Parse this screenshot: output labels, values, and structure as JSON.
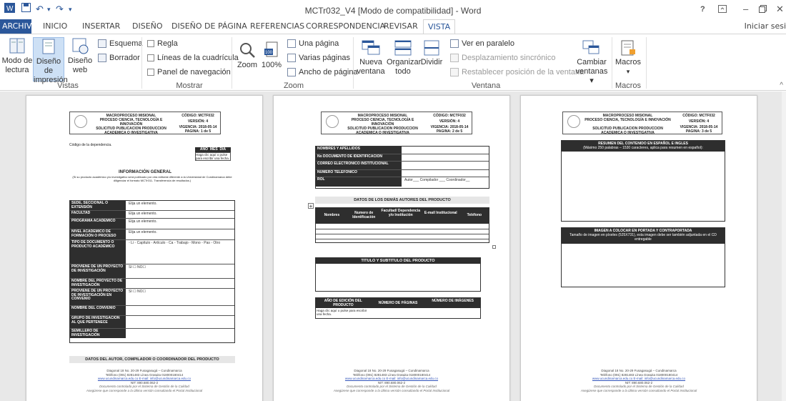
{
  "titlebar": {
    "title": "MCTr032_V4 [Modo de compatibilidad] - Word",
    "help": "?",
    "undo_glyph": "↶",
    "redo_glyph": "↷",
    "more_glyph": "▾",
    "minimize_glyph": "–",
    "close_glyph": "✕"
  },
  "tabs": [
    "ARCHIVO",
    "INICIO",
    "INSERTAR",
    "DISEÑO",
    "DISEÑO DE PÁGINA",
    "REFERENCIAS",
    "CORRESPONDENCIA",
    "REVISAR",
    "VISTA"
  ],
  "signin": "Iniciar sesi",
  "ribbon": {
    "vistas": {
      "label": "Vistas",
      "modo_lectura": "Modo de lectura",
      "diseno_impresion": "Diseño de impresión",
      "diseno_web": "Diseño web",
      "esquema": "Esquema",
      "borrador": "Borrador"
    },
    "mostrar": {
      "label": "Mostrar",
      "regla": "Regla",
      "lineas": "Líneas de la cuadrícula",
      "panel": "Panel de navegación"
    },
    "zoom": {
      "label": "Zoom",
      "zoom": "Zoom",
      "pct": "100%",
      "una_pagina": "Una página",
      "varias_paginas": "Varias páginas",
      "ancho_pagina": "Ancho de página"
    },
    "ventana": {
      "label": "Ventana",
      "nueva": "Nueva ventana",
      "organizar": "Organizar todo",
      "dividir": "Dividir",
      "paralelo": "Ver en paralelo",
      "desplazamiento": "Desplazamiento sincrónico",
      "restablecer": "Restablecer posición de la ventana",
      "cambiar": "Cambiar ventanas ▾"
    },
    "macros": {
      "label": "Macros",
      "macros": "Macros",
      "arrow": "▾"
    }
  },
  "doc_header": {
    "line1": "MACROPROCESO MISIONAL",
    "line2": "PROCESO CIENCIA, TECNOLOGÍA E INNOVACIÓN",
    "line3": "SOLICITUD PUBLICACION PRODUCCION ACADEMICA O INVESTIGATIVA",
    "codigo": "CÓDIGO: MCTF032",
    "version": "VERSIÓN: 4",
    "vigencia": "VIGENCIA: 2018-05-14",
    "pag1": "PAGINA: 1 de 5",
    "pag2": "PAGINA: 2 de 5",
    "pag3": "PAGINA: 3 de 5"
  },
  "page1": {
    "codigo_dep": "Código de la dependencia.",
    "fecha_head": [
      "AÑO",
      "MES",
      "DÍA"
    ],
    "fecha_val": "Haga clic aquí o pulse para escribir una fecha.",
    "info_general": "INFORMACIÓN GENERAL",
    "info_note": "(Si su producto académico y/o investigativo será publicado por otra editorial diferente a la Universidad de Cundinamarca debe diligenciar el formato MCTr011- Transferencia de resultados.)",
    "rows": [
      {
        "label": "SEDE, SECCIONAL O EXTENSIÓN",
        "value": "Elija un elemento."
      },
      {
        "label": "FACULTAD",
        "value": "Elija un elemento."
      },
      {
        "label": "PROGRAMA ACADÉMICO",
        "value": "Elija un elemento."
      },
      {
        "label": "NIVEL ACADÉMICO DE FORMACIÓN O PROCESO",
        "value": "Elija un elemento."
      },
      {
        "label": "TIPO DE DOCUMENTO O PRODUCTO ACADÉMICO",
        "value": "◦ Li ◦ Capítulo ◦ Artículo ◦ Ca ◦ Trabajo ◦ Mono ◦ Pas ◦ Otro"
      },
      {
        "label": "PROVIENE DE UN PROYECTO DE INVESTIGACIÓN",
        "value": "SI ☐      NO☐"
      },
      {
        "label": "NOMBRE DEL PROYECTO DE INVESTIGACIÓN",
        "value": ""
      },
      {
        "label": "PROVIENE DE UN PROYECTO DE INVESTIGACIÓN EN CONVENIO",
        "value": "SI ☐      NO☐"
      },
      {
        "label": "NOMBRE DEL CONVENIO",
        "value": ""
      },
      {
        "label": "GRUPO DE INVESTIGACIÓN AL QUE PERTENECE",
        "value": ""
      },
      {
        "label": "SEMILLERO DE INVESTIGACIÓN",
        "value": ""
      }
    ],
    "datos_autor": "DATOS DEL AUTOR, COMPILADOR O COORDINADOR DEL PRODUCTO"
  },
  "page2": {
    "rows": [
      {
        "label": "NOMBRES Y APELLIDOS",
        "value": ""
      },
      {
        "label": "No DOCUMENTO DE IDENTIFICACIÓN",
        "value": ""
      },
      {
        "label": "CORREO ELECTRONICO INSTITUCIONAL",
        "value": ""
      },
      {
        "label": "NUMERO TELEFONICO",
        "value": ""
      },
      {
        "label": "ROL",
        "value": "Autor___ Compilador ___ Coordinador__"
      }
    ],
    "demas_autores": "DATOS DE LOS DEMÁS AUTORES DEL PRODUCTO",
    "author_cols": [
      "Nombres",
      "Numero de Identificación",
      "Facultad/ Dependencia y/o Institución",
      "E-mail Institucional",
      "Teléfono"
    ],
    "titulo_subtitulo": "TITULO Y SUBTITULO DEL PRODUCTO",
    "bottom_cols": [
      "AÑO DE EDICIÓN DEL PRODUCTO",
      "NÚMERO DE PÁGINAS",
      "NÚMERO DE IMÁGENES"
    ],
    "bottom_val": "Haga clic aquí o pulse para escribir una fecha."
  },
  "page3": {
    "resumen_title": "RESUMEN DEL CONTENIDO EN ESPAÑOL E INGLES",
    "resumen_note": "(Máximo 250 palabras – 1530 caracteres, aplica para resumen en español):",
    "imagen_title": "IMAGEN A COLOCAR EN PORTADA Y CONTRAPORTADA",
    "imagen_note": "Tamaño de imagen en píxeles (525X731), esta imagen debe ser también adjuntada en el CD entregable"
  },
  "footer": {
    "line1": "Diagonal 18 No. 20-29 Fusagasugá – Cundinamarca",
    "line2": "Teléfono (091) 8281483  Línea Gratuita 018000180414",
    "email": "www.ucundinamarca.edu.co   E-mail: info@ucundinamarca.edu.co",
    "nit": "NIT: 890.680.062-2",
    "note1": "Documento controlado por el Sistema de Gestión de la Calidad",
    "note2": "Asegúrese que corresponde a la última versión consultando el Portal Institucional"
  }
}
